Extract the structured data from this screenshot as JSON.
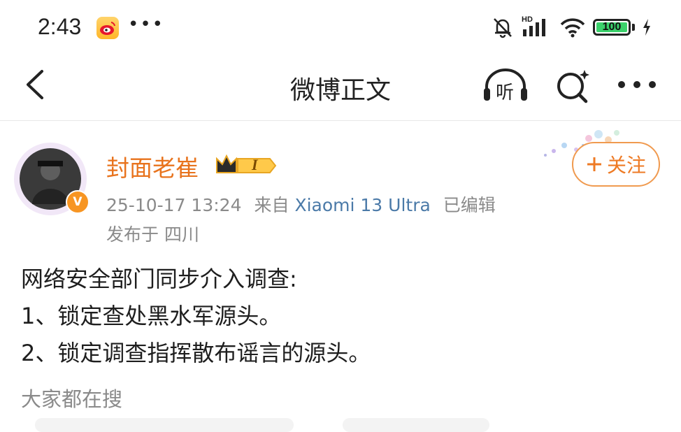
{
  "status_bar": {
    "time": "2:43",
    "dots": "•••",
    "battery": "100",
    "network": "HD"
  },
  "nav": {
    "title": "微博正文",
    "listen_label": "听"
  },
  "post": {
    "author": {
      "name": "封面老崔",
      "verified": "V",
      "level_badge": "I"
    },
    "timestamp": "25-10-17 13:24",
    "source_prefix": "来自",
    "device": "Xiaomi 13 Ultra",
    "edited": "已编辑",
    "location": "发布于 四川",
    "follow_label": "关注",
    "body_lines": [
      "网络安全部门同步介入调查:",
      "1、锁定查处黑水军源头。",
      "2、锁定调查指挥散布谣言的源头。"
    ]
  },
  "related": {
    "label": "大家都在搜"
  },
  "colors": {
    "accent": "#ee7a24",
    "link": "#4b7aa8",
    "meta": "#8a8a8a"
  }
}
